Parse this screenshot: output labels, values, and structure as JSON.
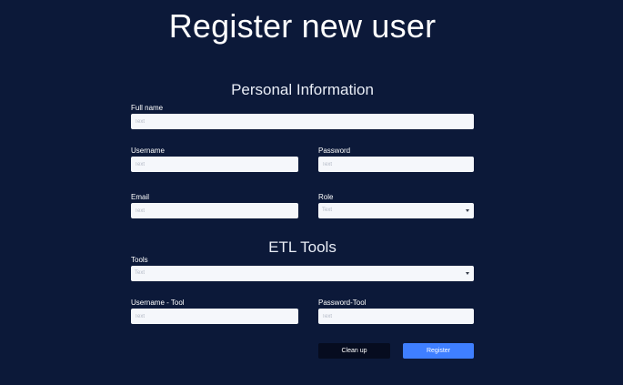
{
  "page": {
    "title": "Register new user"
  },
  "personal": {
    "title": "Personal Information",
    "full_name": {
      "label": "Full name",
      "placeholder": "Text"
    },
    "username": {
      "label": "Username",
      "placeholder": "Text"
    },
    "password": {
      "label": "Password",
      "placeholder": "Text"
    },
    "email": {
      "label": "Email",
      "placeholder": "Text"
    },
    "role": {
      "label": "Role",
      "placeholder": "Text"
    }
  },
  "etl": {
    "title": "ETL Tools",
    "tools": {
      "label": "Tools",
      "placeholder": "Text"
    },
    "username_tool": {
      "label": "Username - Tool",
      "placeholder": "Text"
    },
    "password_tool": {
      "label": "Password-Tool",
      "placeholder": "Text"
    }
  },
  "actions": {
    "cleanup_label": "Clean up",
    "register_label": "Register"
  },
  "icons": {
    "select_caret": "chevron-down-icon"
  },
  "colors": {
    "background": "#0c1939",
    "input_background": "#f5f7fb",
    "register_button": "#3f7fff",
    "cleanup_button": "#060c1f"
  }
}
